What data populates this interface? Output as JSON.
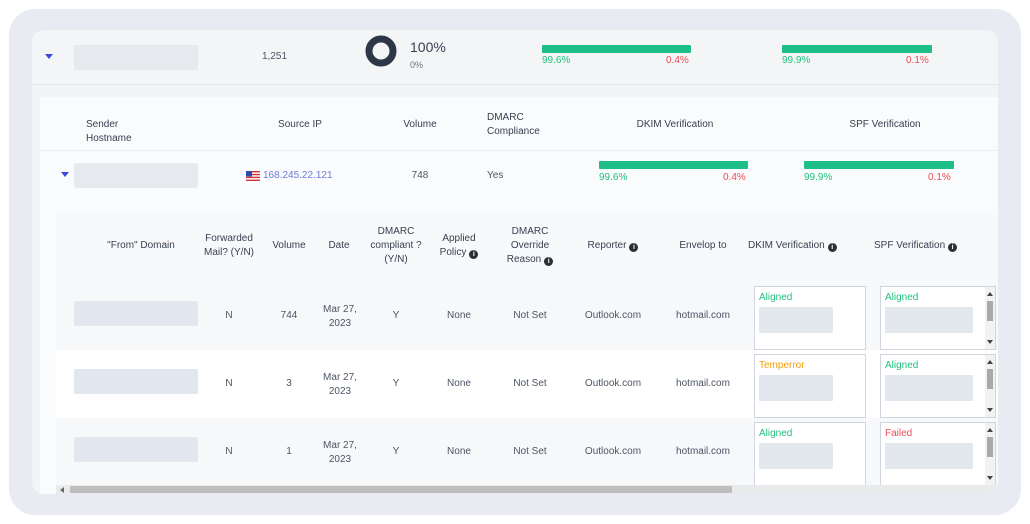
{
  "summary": {
    "volume": "1,251",
    "compliance_pct": "100%",
    "noncompliance_pct": "0%",
    "dkim": {
      "pass": "99.6%",
      "fail": "0.4%",
      "pass_fraction": 0.996
    },
    "spf": {
      "pass": "99.9%",
      "fail": "0.1%",
      "pass_fraction": 0.999
    }
  },
  "sender_table": {
    "headers": [
      "Sender Hostname",
      "Source IP",
      "Volume",
      "DMARC Compliance",
      "DKIM Verification",
      "SPF Verification"
    ],
    "row": {
      "source_ip": "168.245.22.121",
      "volume": "748",
      "compliance": "Yes",
      "dkim": {
        "pass": "99.6%",
        "fail": "0.4%",
        "pass_fraction": 0.996
      },
      "spf": {
        "pass": "99.9%",
        "fail": "0.1%",
        "pass_fraction": 0.999
      }
    }
  },
  "detail_table": {
    "headers": {
      "from_domain": "\"From\" Domain",
      "forwarded": "Forwarded Mail? (Y/N)",
      "volume": "Volume",
      "date": "Date",
      "compliant": "DMARC compliant ? (Y/N)",
      "applied_policy": "Applied Policy",
      "override_reason": "DMARC Override Reason",
      "reporter": "Reporter",
      "envelop_to": "Envelop to",
      "dkim": "DKIM Verification",
      "spf": "SPF Verification"
    },
    "rows": [
      {
        "forwarded": "N",
        "volume": "744",
        "date": "Mar 27, 2023",
        "compliant": "Y",
        "policy": "None",
        "override": "Not Set",
        "reporter": "Outlook.com",
        "envelop_to": "hotmail.com",
        "dkim": "Aligned",
        "spf": "Aligned"
      },
      {
        "forwarded": "N",
        "volume": "3",
        "date": "Mar 27, 2023",
        "compliant": "Y",
        "policy": "None",
        "override": "Not Set",
        "reporter": "Outlook.com",
        "envelop_to": "hotmail.com",
        "dkim": "Temperror",
        "spf": "Aligned"
      },
      {
        "forwarded": "N",
        "volume": "1",
        "date": "Mar 27, 2023",
        "compliant": "Y",
        "policy": "None",
        "override": "Not Set",
        "reporter": "Outlook.com",
        "envelop_to": "hotmail.com",
        "dkim": "Aligned",
        "spf": "Failed"
      }
    ]
  },
  "colors": {
    "pass": "#22c07d",
    "fail": "#ef4b54",
    "warn": "#f59e0b",
    "bar": "#1dbf86",
    "accent": "#3b4bd8"
  },
  "icons": [
    "caret-down-icon",
    "donut-chart-icon",
    "us-flag-icon",
    "info-icon",
    "scroll-up-icon",
    "scroll-down-icon"
  ]
}
